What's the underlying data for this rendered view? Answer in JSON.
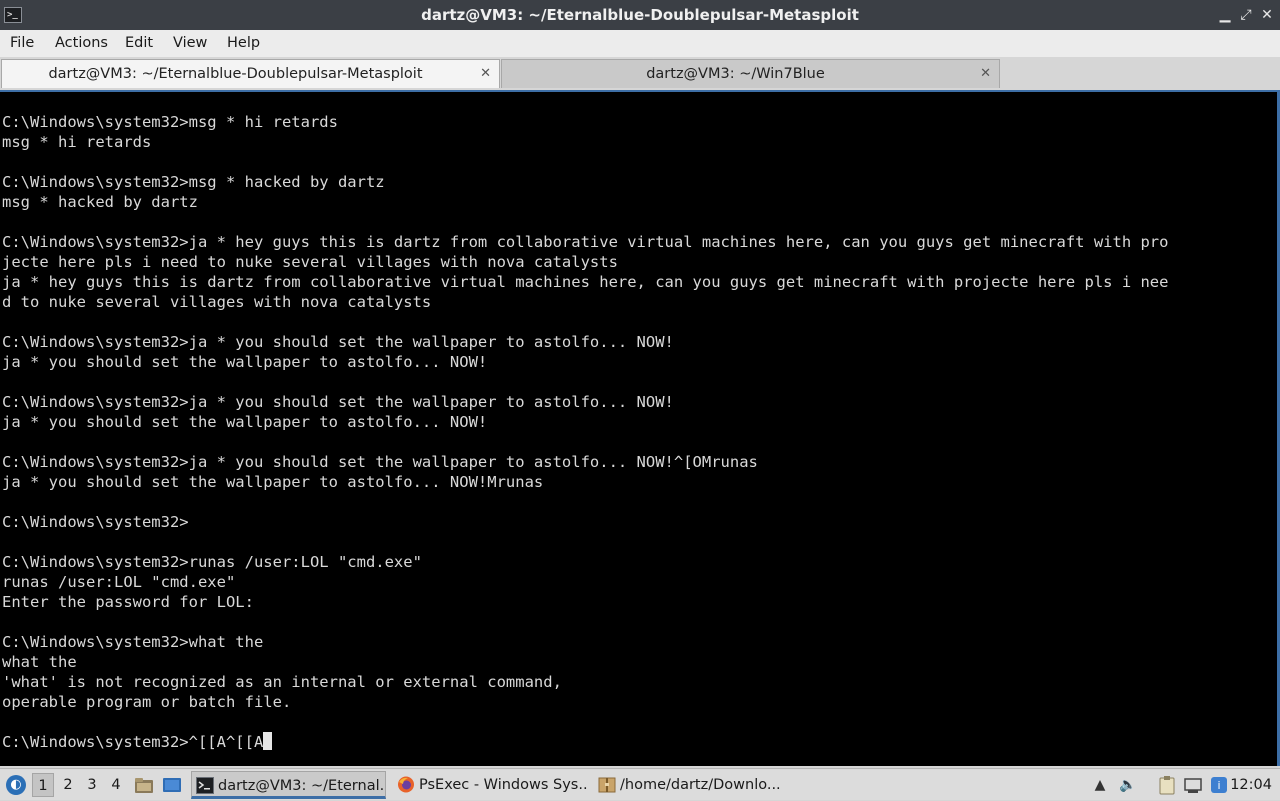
{
  "window": {
    "title": "dartz@VM3: ~/Eternalblue-Doublepulsar-Metasploit",
    "app_icon": "terminal-icon",
    "app_icon_text": ">_",
    "minimize_glyph": "▁",
    "maximize_glyph": "⤢",
    "close_glyph": "✕"
  },
  "menu": {
    "items": [
      "File",
      "Actions",
      "Edit",
      "View",
      "Help"
    ]
  },
  "tabs": [
    {
      "label": "dartz@VM3: ~/Eternalblue-Doublepulsar-Metasploit",
      "active": true,
      "close": "✕"
    },
    {
      "label": "dartz@VM3: ~/Win7Blue",
      "active": false,
      "close": "✕"
    }
  ],
  "terminal": {
    "lines": [
      "C:\\Windows\\system32>msg * hi retards",
      "msg * hi retards",
      "",
      "C:\\Windows\\system32>msg * hacked by dartz",
      "msg * hacked by dartz",
      "",
      "C:\\Windows\\system32>ja * hey guys this is dartz from collaborative virtual machines here, can you guys get minecraft with pro",
      "jecte here pls i need to nuke several villages with nova catalysts",
      "ja * hey guys this is dartz from collaborative virtual machines here, can you guys get minecraft with projecte here pls i nee",
      "d to nuke several villages with nova catalysts",
      "",
      "C:\\Windows\\system32>ja * you should set the wallpaper to astolfo... NOW!",
      "ja * you should set the wallpaper to astolfo... NOW!",
      "",
      "C:\\Windows\\system32>ja * you should set the wallpaper to astolfo... NOW!",
      "ja * you should set the wallpaper to astolfo... NOW!",
      "",
      "C:\\Windows\\system32>ja * you should set the wallpaper to astolfo... NOW!^[OMrunas",
      "ja * you should set the wallpaper to astolfo... NOW!Mrunas",
      "",
      "C:\\Windows\\system32>",
      "",
      "C:\\Windows\\system32>runas /user:LOL \"cmd.exe\"",
      "runas /user:LOL \"cmd.exe\"",
      "Enter the password for LOL:",
      "",
      "C:\\Windows\\system32>what the",
      "what the",
      "'what' is not recognized as an internal or external command,",
      "operable program or batch file.",
      ""
    ],
    "prompt_line": "C:\\Windows\\system32>^[[A^[[A"
  },
  "taskbar": {
    "start_icon": "app-menu-icon",
    "workspaces": [
      "1",
      "2",
      "3",
      "4"
    ],
    "active_workspace": "1",
    "tasks": [
      {
        "label": "dartz@VM3: ~/Eternal...",
        "icon": "terminal-icon",
        "active": true
      },
      {
        "label": "PsExec - Windows Sys...",
        "icon": "firefox-icon",
        "active": false
      },
      {
        "label": "/home/dartz/Downlo...",
        "icon": "archive-icon",
        "active": false
      }
    ],
    "clock": "12:04"
  },
  "colors": {
    "terminal_bg": "#000000",
    "terminal_fg": "#d9d9d9",
    "accent": "#3d6ea6",
    "titlebar_bg": "#3b3f45"
  }
}
